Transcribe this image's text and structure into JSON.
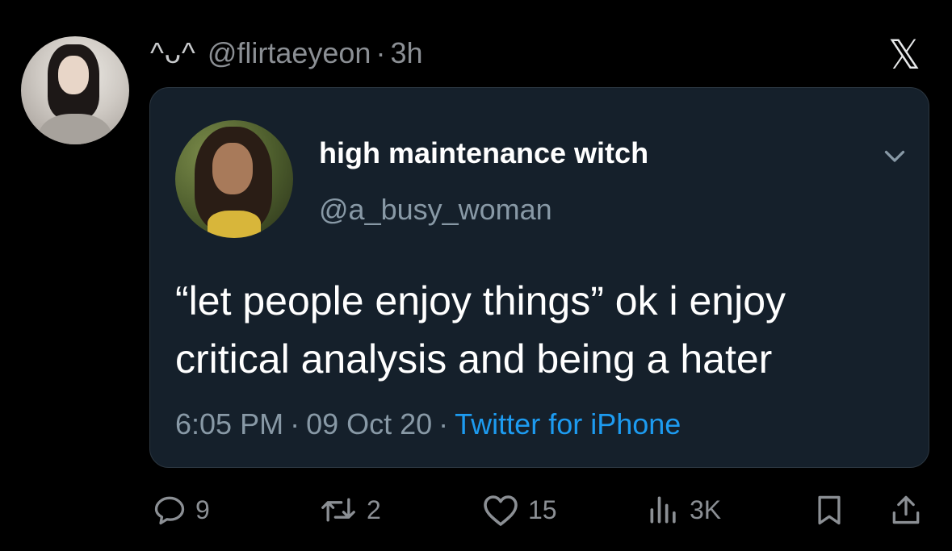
{
  "header": {
    "display_name": "^ᴗ^",
    "handle": "@flirtaeyeon",
    "separator": "·",
    "time_ago": "3h",
    "platform_logo": "𝕏"
  },
  "quoted": {
    "display_name": "high maintenance witch",
    "handle": "@a_busy_woman",
    "text": "“let people enjoy things” ok i enjoy\ncritical analysis and being a hater",
    "time": "6:05 PM",
    "sep1": "·",
    "date": "09 Oct 20",
    "sep2": "·",
    "source": "Twitter for iPhone",
    "menu_icon": "chevron-down-icon"
  },
  "actions": {
    "replies": "9",
    "retweets": "2",
    "likes": "15",
    "views": "3K",
    "icons": [
      "reply-icon",
      "retweet-icon",
      "like-icon",
      "views-icon",
      "bookmark-icon",
      "share-icon"
    ]
  },
  "colors": {
    "background": "#000000",
    "card": "#15202b",
    "link": "#1d9bf0",
    "muted": "#8b8f94"
  }
}
